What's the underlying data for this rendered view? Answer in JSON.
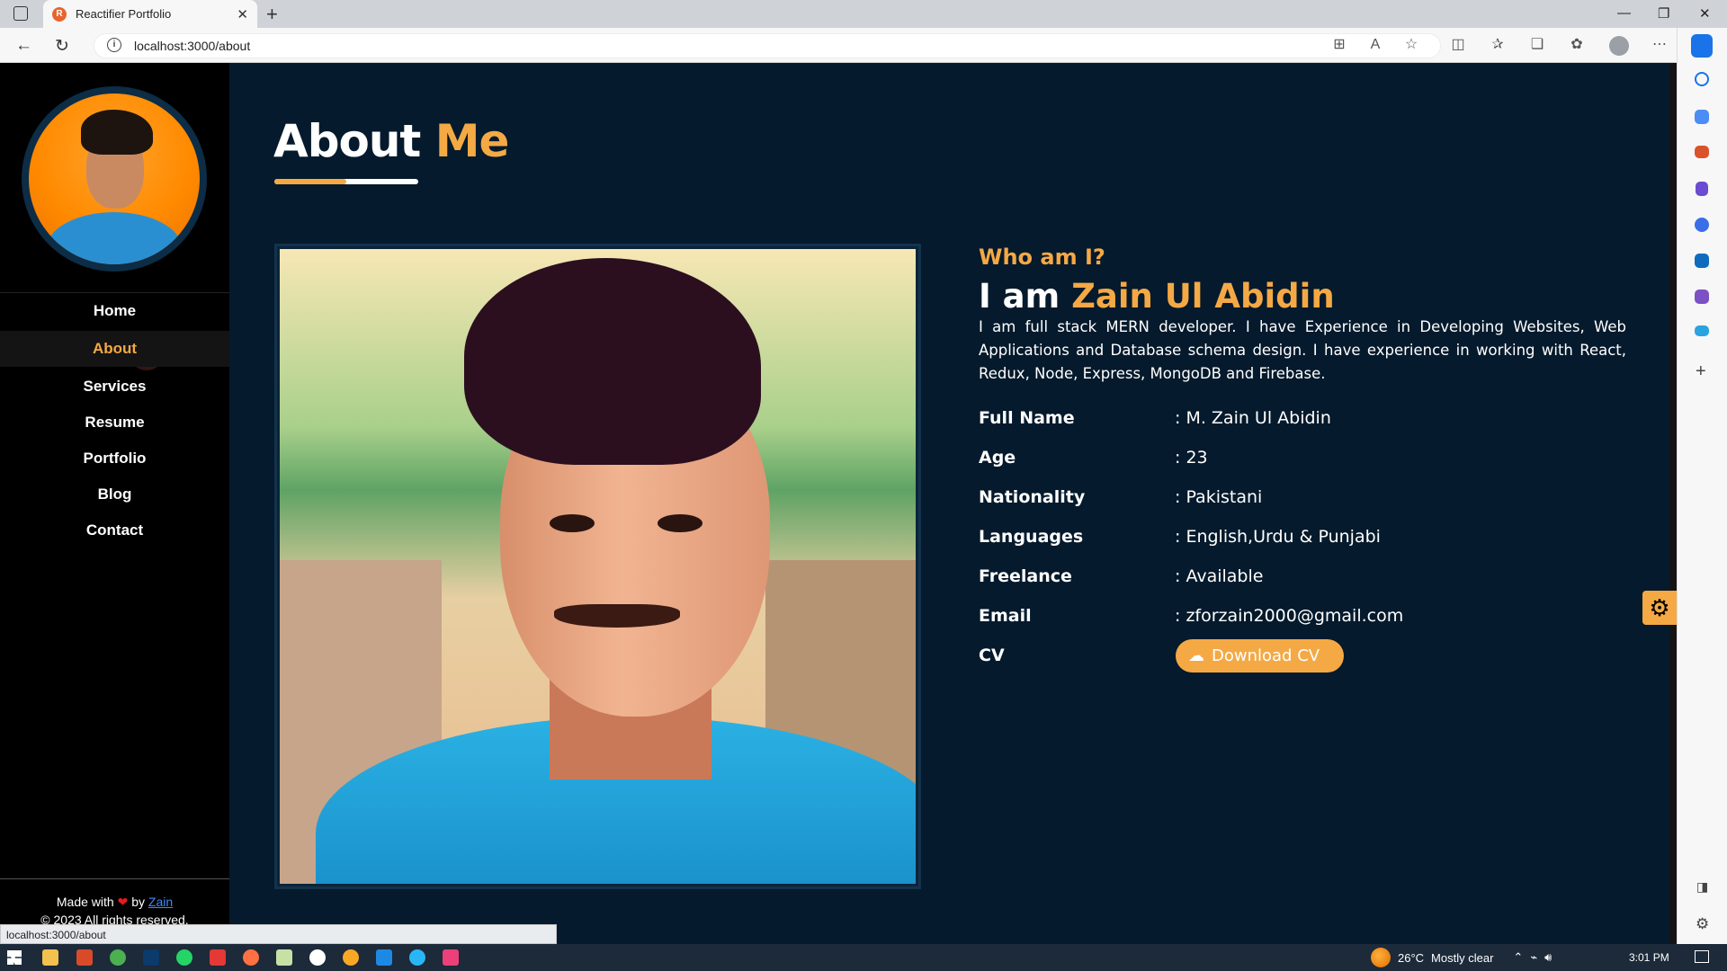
{
  "browser": {
    "tab_title": "Reactifier Portfolio",
    "tab_favicon": "R",
    "url": "localhost:3000/about",
    "status_url": "localhost:3000/about"
  },
  "sidebar": {
    "nav": [
      {
        "label": "Home",
        "active": false
      },
      {
        "label": "About",
        "active": true
      },
      {
        "label": "Services",
        "active": false
      },
      {
        "label": "Resume",
        "active": false
      },
      {
        "label": "Portfolio",
        "active": false
      },
      {
        "label": "Blog",
        "active": false
      },
      {
        "label": "Contact",
        "active": false
      }
    ],
    "footer": {
      "made_with": "Made with",
      "by": "by",
      "author_link": "Zain",
      "copyright": "© 2023 All rights reserved."
    }
  },
  "main": {
    "title_part1": "About",
    "title_part2": "Me",
    "who_heading": "Who am I?",
    "iam_prefix": "I am",
    "name": "Zain Ul Abidin",
    "bio": "I am full stack MERN developer. I have Experience in Developing Websites, Web Applications and Database schema design. I have experience in working with React, Redux, Node, Express, MongoDB and Firebase.",
    "details": [
      {
        "label": "Full Name",
        "value": ": M. Zain Ul Abidin"
      },
      {
        "label": "Age",
        "value": ": 23"
      },
      {
        "label": "Nationality",
        "value": ": Pakistani"
      },
      {
        "label": "Languages",
        "value": ": English,Urdu & Punjabi"
      },
      {
        "label": "Freelance",
        "value": ": Available"
      },
      {
        "label": "Email",
        "value": ": zforzain2000@gmail.com"
      }
    ],
    "cv_label": "CV",
    "download_button": "Download CV"
  },
  "taskbar": {
    "temperature": "26°C",
    "weather": "Mostly clear",
    "time": "3:01 PM"
  },
  "colors": {
    "accent": "#f4a945",
    "background": "#051a2c",
    "sidebar": "#000000"
  }
}
